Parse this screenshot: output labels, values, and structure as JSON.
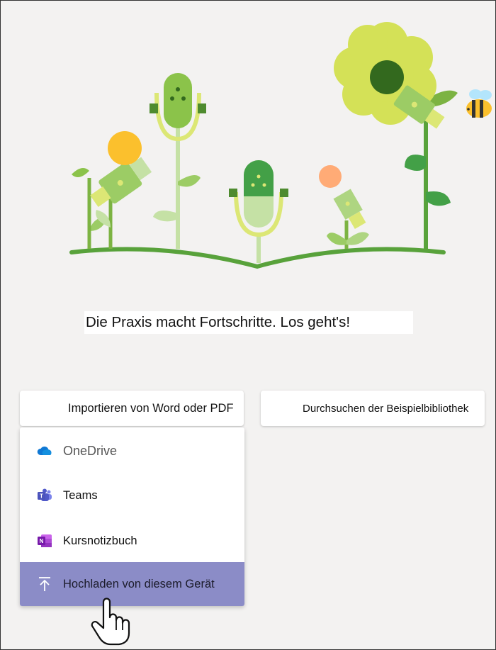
{
  "headline": "Die Praxis macht Fortschritte. Los geht's!",
  "buttons": {
    "import": "Importieren von Word oder PDF",
    "browse": "Durchsuchen der Beispielbibliothek"
  },
  "menu": {
    "items": [
      {
        "label": "OneDrive",
        "icon": "onedrive-icon"
      },
      {
        "label": "Teams",
        "icon": "teams-icon"
      },
      {
        "label": "Kursnotizbuch",
        "icon": "onenote-icon"
      },
      {
        "label": "Hochladen von diesem Gerät",
        "icon": "upload-icon",
        "highlighted": true
      }
    ]
  },
  "colors": {
    "background": "#f3f2f1",
    "highlight": "#8b8cc7",
    "teams": "#5059c9",
    "onenote": "#7719aa",
    "onedrive": "#0f78d4"
  }
}
